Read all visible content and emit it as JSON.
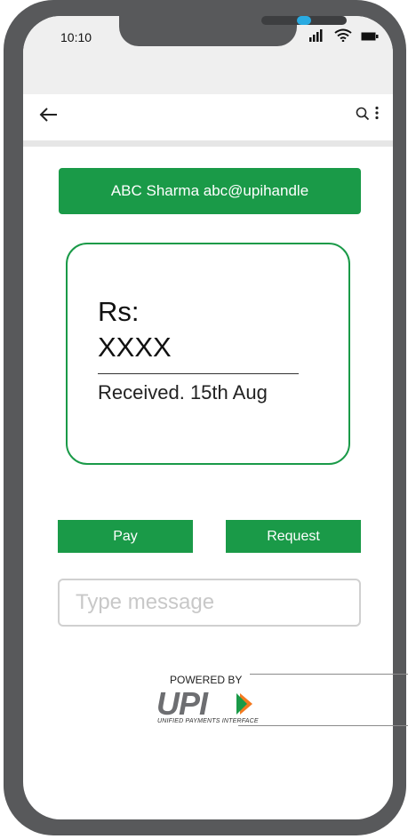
{
  "status_bar": {
    "time": "10:10",
    "icons": [
      "signal-icon",
      "wifi-icon",
      "battery-icon"
    ]
  },
  "app_bar": {
    "back_icon": "arrow-left-icon",
    "search_icon": "search-icon",
    "more_icon": "more-vertical-icon"
  },
  "payee": {
    "label": "ABC Sharma abc@upihandle"
  },
  "transaction": {
    "currency_label": "Rs:",
    "amount": "XXXX",
    "status": "Received. 15th Aug"
  },
  "actions": {
    "pay_label": "Pay",
    "request_label": "Request"
  },
  "message": {
    "placeholder": "Type message",
    "value": ""
  },
  "footer": {
    "powered_by": "POWERED BY",
    "upi_logo_text": "UPI",
    "upi_subtitle": "UNIFIED PAYMENTS INTERFACE"
  },
  "colors": {
    "brand_green": "#1a9a48",
    "phone_frame": "#58595b",
    "camera": "#29abe2"
  }
}
